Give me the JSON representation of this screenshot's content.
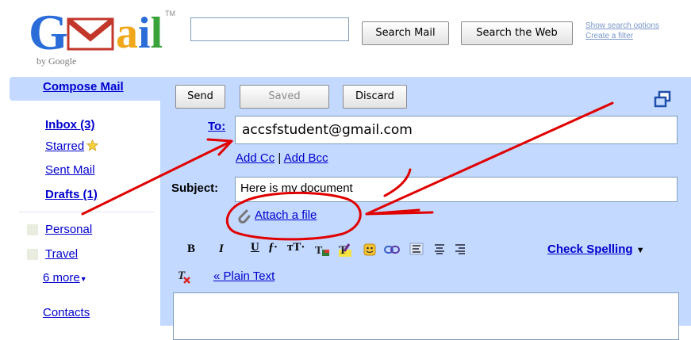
{
  "logo": {
    "main": "Gmail",
    "tagline": "by Google"
  },
  "search": {
    "query": "",
    "search_mail_label": "Search Mail",
    "search_web_label": "Search the Web",
    "show_options_label": "Show search options",
    "create_filter_label": "Create a filter"
  },
  "nav": {
    "compose": "Compose Mail",
    "inbox": "Inbox (3)",
    "starred": "Starred",
    "sent": "Sent Mail",
    "drafts": "Drafts (1)",
    "labels": [
      "Personal",
      "Travel"
    ],
    "more": "6 more",
    "contacts": "Contacts"
  },
  "compose": {
    "send_label": "Send",
    "saved_label": "Saved",
    "discard_label": "Discard",
    "to_label": "To:",
    "to_value": "accsfstudent@gmail.com",
    "add_cc": "Add Cc",
    "separator": "|",
    "add_bcc": "Add Bcc",
    "subject_label": "Subject:",
    "subject_value": "Here is my document",
    "attach_label": "Attach a file",
    "check_spelling": "Check Spelling",
    "plain_text": "« Plain Text"
  },
  "colors": {
    "panel": "#c3d9ff",
    "link": "#0000cc",
    "annotation": "#e00000"
  },
  "icons": [
    "star-icon",
    "paperclip-icon",
    "popout-icon",
    "bold-icon",
    "italic-icon",
    "underline-icon",
    "font-icon",
    "font-size-icon",
    "text-color-icon",
    "highlight-icon",
    "emoticon-icon",
    "link-icon",
    "numbered-list-icon",
    "bullet-list-icon",
    "indent-icon",
    "remove-formatting-icon",
    "dropdown-arrow-icon"
  ]
}
